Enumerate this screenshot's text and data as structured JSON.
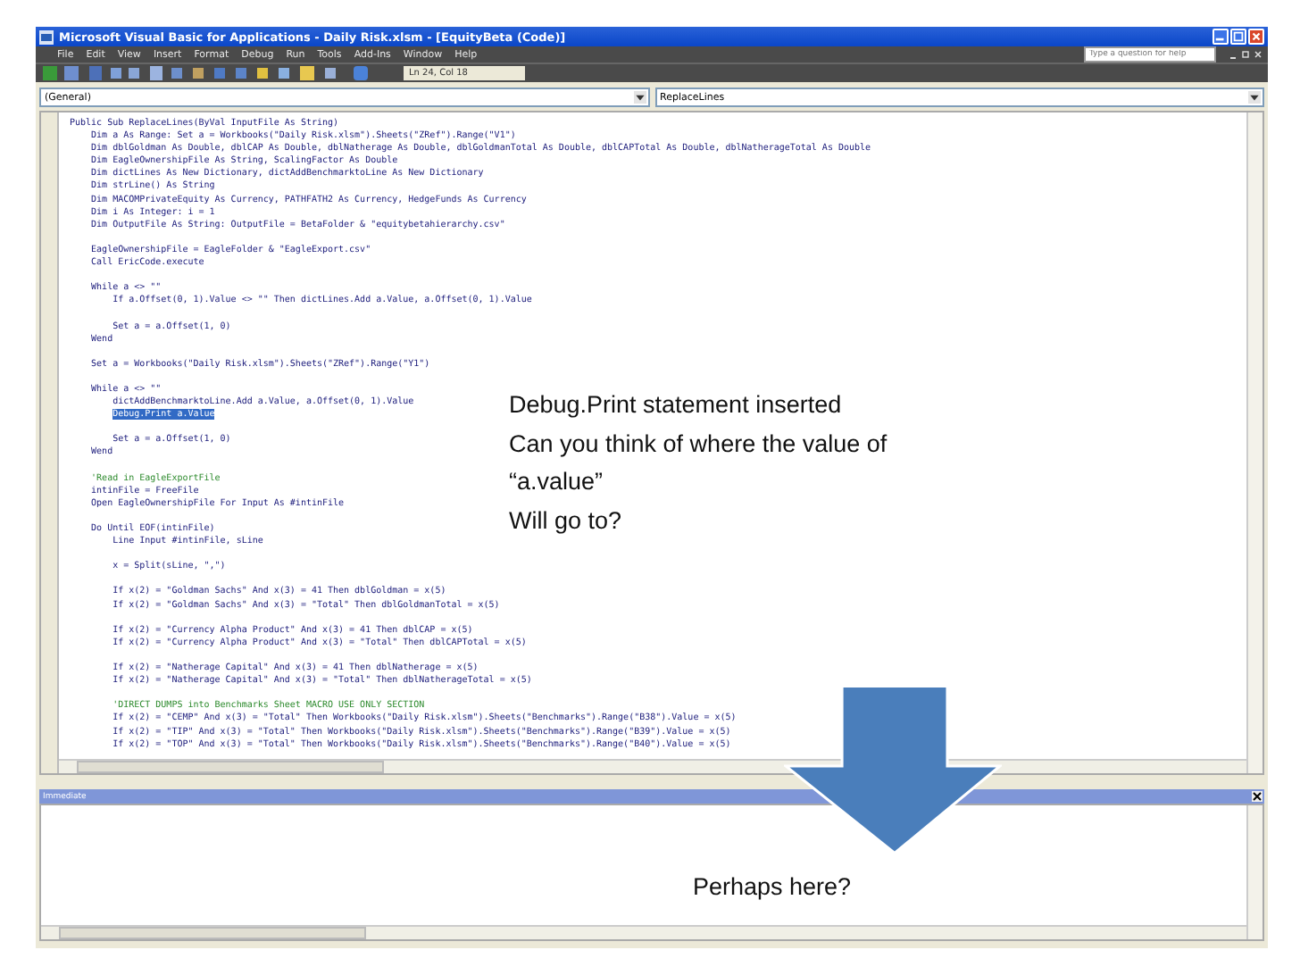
{
  "window": {
    "title": "Microsoft Visual Basic for Applications - Daily Risk.xlsm - [EquityBeta (Code)]"
  },
  "menu": [
    "File",
    "Edit",
    "View",
    "Insert",
    "Format",
    "Debug",
    "Run",
    "Tools",
    "Add-Ins",
    "Window",
    "Help"
  ],
  "toolbar": {
    "position": "Ln 24, Col 18"
  },
  "help_box": {
    "placeholder": "Type a question for help"
  },
  "object_combo": {
    "value": "(General)"
  },
  "procedure_combo": {
    "value": "ReplaceLines"
  },
  "code_lines": [
    {
      "kind": "code",
      "text": "Public Sub ReplaceLines(ByVal InputFile As String)"
    },
    {
      "kind": "code",
      "text": "    Dim a As Range: Set a = Workbooks(\"Daily Risk.xlsm\").Sheets(\"ZRef\").Range(\"V1\")"
    },
    {
      "kind": "code",
      "text": "    Dim dblGoldman As Double, dblCAP As Double, dblNatherage As Double, dblGoldmanTotal As Double, dblCAPTotal As Double, dblNatherageTotal As Double"
    },
    {
      "kind": "code",
      "text": "    Dim EagleOwnershipFile As String, ScalingFactor As Double"
    },
    {
      "kind": "code",
      "text": "    Dim dictLines As New Dictionary, dictAddBenchmarktoLine As New Dictionary"
    },
    {
      "kind": "code",
      "text": "    Dim strLine() As String"
    },
    {
      "kind": "code",
      "text": "    Dim MACOMPrivateEquity As Currency, PATHFATH2 As Currency, HedgeFunds As Currency"
    },
    {
      "kind": "code",
      "text": "    Dim i As Integer: i = 1"
    },
    {
      "kind": "code",
      "text": "    Dim OutputFile As String: OutputFile = BetaFolder & \"equitybetahierarchy.csv\""
    },
    {
      "kind": "blank"
    },
    {
      "kind": "code",
      "text": "    EagleOwnershipFile = EagleFolder & \"EagleExport.csv\""
    },
    {
      "kind": "code",
      "text": "    Call EricCode.execute"
    },
    {
      "kind": "blank"
    },
    {
      "kind": "code",
      "text": "    While a <> \"\""
    },
    {
      "kind": "code",
      "text": "        If a.Offset(0, 1).Value <> \"\" Then dictLines.Add a.Value, a.Offset(0, 1).Value"
    },
    {
      "kind": "blank"
    },
    {
      "kind": "code",
      "text": "        Set a = a.Offset(1, 0)"
    },
    {
      "kind": "code",
      "text": "    Wend"
    },
    {
      "kind": "blank"
    },
    {
      "kind": "code",
      "text": "    Set a = Workbooks(\"Daily Risk.xlsm\").Sheets(\"ZRef\").Range(\"Y1\")"
    },
    {
      "kind": "blank"
    },
    {
      "kind": "code",
      "text": "    While a <> \"\""
    },
    {
      "kind": "code",
      "text": "        dictAddBenchmarktoLine.Add a.Value, a.Offset(0, 1).Value"
    },
    {
      "kind": "selection",
      "text": "Debug.Print a.Value"
    },
    {
      "kind": "blank"
    },
    {
      "kind": "code",
      "text": "        Set a = a.Offset(1, 0)"
    },
    {
      "kind": "code",
      "text": "    Wend"
    },
    {
      "kind": "blank"
    },
    {
      "kind": "comment",
      "text": "    'Read in EagleExportFile"
    },
    {
      "kind": "code",
      "text": "    intinFile = FreeFile"
    },
    {
      "kind": "code",
      "text": "    Open EagleOwnershipFile For Input As #intinFile"
    },
    {
      "kind": "blank"
    },
    {
      "kind": "code",
      "text": "    Do Until EOF(intinFile)"
    },
    {
      "kind": "code",
      "text": "        Line Input #intinFile, sLine"
    },
    {
      "kind": "blank"
    },
    {
      "kind": "code",
      "text": "        x = Split(sLine, \",\")"
    },
    {
      "kind": "blank"
    },
    {
      "kind": "code",
      "text": "        If x(2) = \"Goldman Sachs\" And x(3) = 41 Then dblGoldman = x(5)"
    },
    {
      "kind": "code",
      "text": "        If x(2) = \"Goldman Sachs\" And x(3) = \"Total\" Then dblGoldmanTotal = x(5)"
    },
    {
      "kind": "blank"
    },
    {
      "kind": "code",
      "text": "        If x(2) = \"Currency Alpha Product\" And x(3) = 41 Then dblCAP = x(5)"
    },
    {
      "kind": "code",
      "text": "        If x(2) = \"Currency Alpha Product\" And x(3) = \"Total\" Then dblCAPTotal = x(5)"
    },
    {
      "kind": "blank"
    },
    {
      "kind": "code",
      "text": "        If x(2) = \"Natherage Capital\" And x(3) = 41 Then dblNatherage = x(5)"
    },
    {
      "kind": "code",
      "text": "        If x(2) = \"Natherage Capital\" And x(3) = \"Total\" Then dblNatherageTotal = x(5)"
    },
    {
      "kind": "blank"
    },
    {
      "kind": "comment",
      "text": "        'DIRECT DUMPS into Benchmarks Sheet MACRO USE ONLY SECTION"
    },
    {
      "kind": "code",
      "text": "        If x(2) = \"CEMP\" And x(3) = \"Total\" Then Workbooks(\"Daily Risk.xlsm\").Sheets(\"Benchmarks\").Range(\"B38\").Value = x(5)"
    },
    {
      "kind": "code",
      "text": "        If x(2) = \"TIP\" And x(3) = \"Total\" Then Workbooks(\"Daily Risk.xlsm\").Sheets(\"Benchmarks\").Range(\"B39\").Value = x(5)"
    },
    {
      "kind": "code",
      "text": "        If x(2) = \"TOP\" And x(3) = \"Total\" Then Workbooks(\"Daily Risk.xlsm\").Sheets(\"Benchmarks\").Range(\"B40\").Value = x(5)"
    }
  ],
  "immediate_window": {
    "title": "Immediate"
  },
  "callouts": [
    {
      "lines": [
        "Debug.Print statement inserted",
        "Can you think of where the value of",
        "“a.value”",
        "Will go to?"
      ]
    },
    {
      "lines": [
        "Perhaps here?"
      ]
    }
  ]
}
